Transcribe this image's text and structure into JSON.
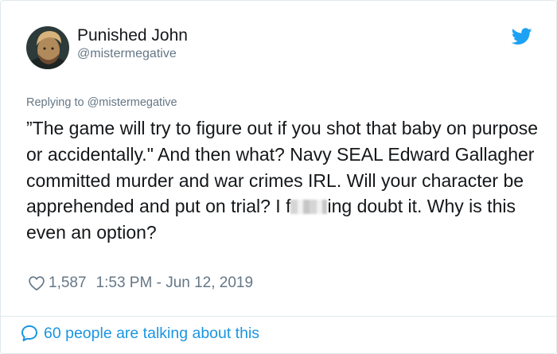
{
  "author": {
    "name": "Punished John",
    "handle": "@mistermegative"
  },
  "reply": {
    "prefix": "Replying to ",
    "handle": "@mistermegative"
  },
  "tweet": {
    "text_part1": "”The game will try to figure out if you shot that baby on purpose or accidentally.\" And then what? Navy SEAL Edward Gallagher committed murder and war crimes IRL. Will your character be apprehended and put on trial? I f",
    "text_part2": "ing doubt it. Why is this even an option?"
  },
  "meta": {
    "likes": "1,587",
    "timestamp": "1:53 PM - Jun 12, 2019"
  },
  "footer": {
    "talking": "60 people are talking about this"
  },
  "icons": {
    "brand": "twitter-bird-icon",
    "like": "heart-icon",
    "comments": "speech-bubble-icon"
  },
  "colors": {
    "accent": "#1b95e0",
    "muted": "#657786",
    "text": "#14171a",
    "border": "#e1e8ed"
  }
}
